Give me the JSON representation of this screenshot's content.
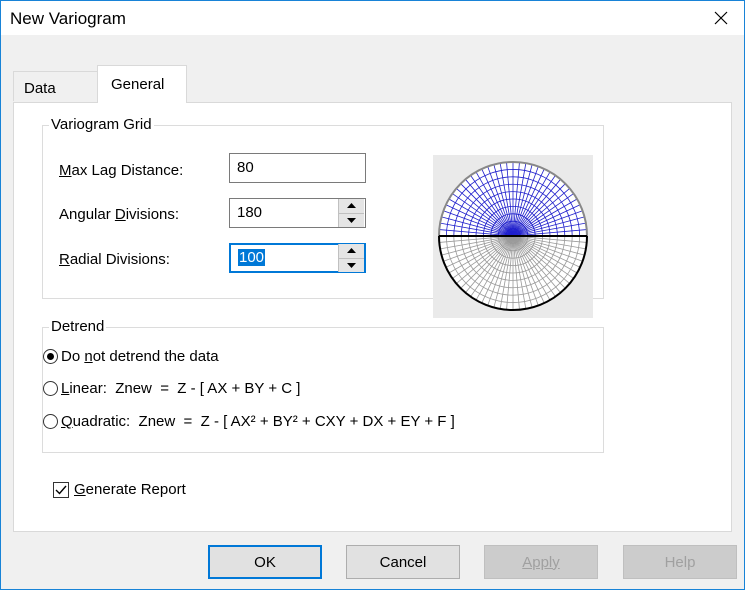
{
  "window": {
    "title": "New Variogram",
    "close_icon": "close-icon"
  },
  "tabs": [
    {
      "label": "Data",
      "active": false
    },
    {
      "label": "General",
      "active": true
    }
  ],
  "variogram_grid": {
    "title": "Variogram Grid",
    "max_lag": {
      "label": "Max Lag Distance:",
      "mnemonic": "M",
      "value": "80"
    },
    "angular": {
      "label": "Angular Divisions:",
      "mnemonic": "D",
      "value": "180"
    },
    "radial": {
      "label": "Radial Divisions:",
      "mnemonic": "R",
      "value": "100"
    },
    "colors": {
      "upper_grid": "#1f1fcc",
      "lower_grid": "#9a9a9a",
      "background": "#eaeaea"
    }
  },
  "detrend": {
    "title": "Detrend",
    "options": [
      {
        "label": "Do not detrend the data",
        "selected": true
      },
      {
        "label": "Linear:  Znew  =  Z - [ AX + BY + C ]",
        "selected": false
      },
      {
        "label": "Quadratic:  Znew  =  Z - [ AX² + BY² + CXY + DX + EY + F ]",
        "selected": false
      }
    ]
  },
  "report": {
    "label": "Generate Report",
    "checked": true
  },
  "buttons": {
    "ok": "OK",
    "cancel": "Cancel",
    "apply": "Apply",
    "help": "Help"
  },
  "colors": {
    "accent": "#0078d7",
    "window_border": "#1883d7"
  }
}
